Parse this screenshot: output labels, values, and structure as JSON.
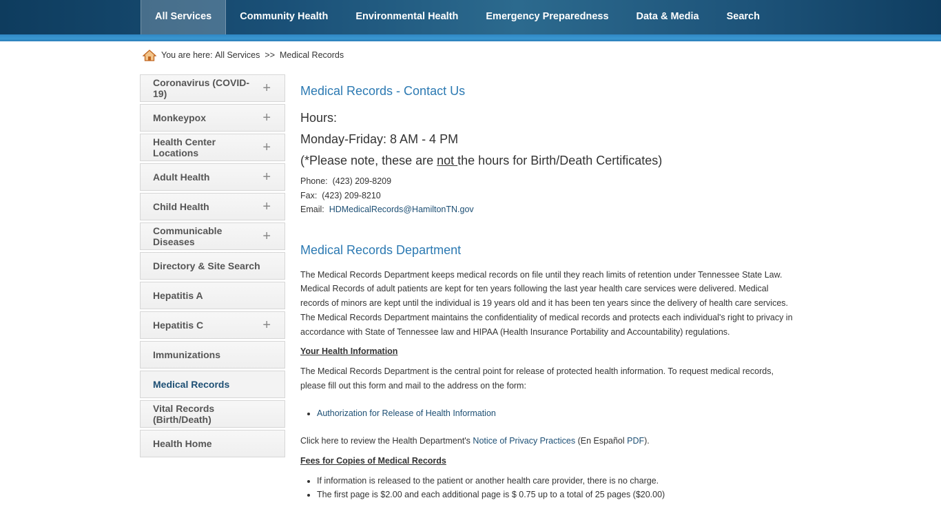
{
  "nav": {
    "items": [
      {
        "label": "All Services",
        "active": true
      },
      {
        "label": "Community Health"
      },
      {
        "label": "Environmental Health"
      },
      {
        "label": "Emergency Preparedness"
      },
      {
        "label": "Data & Media"
      },
      {
        "label": "Search"
      }
    ]
  },
  "breadcrumb": {
    "prefix": "You are here:",
    "parent": "All Services",
    "separator": ">>",
    "current": "Medical Records"
  },
  "sidebar": {
    "items": [
      {
        "label": "Coronavirus (COVID-19)",
        "plus": "+"
      },
      {
        "label": "Monkeypox",
        "plus": "+"
      },
      {
        "label": "Health Center Locations",
        "plus": "+"
      },
      {
        "label": "Adult Health",
        "plus": "+"
      },
      {
        "label": "Child Health",
        "plus": "+"
      },
      {
        "label": "Communicable Diseases",
        "plus": "+"
      },
      {
        "label": "Directory & Site Search",
        "plus": ""
      },
      {
        "label": "Hepatitis A",
        "plus": ""
      },
      {
        "label": "Hepatitis C",
        "plus": "+"
      },
      {
        "label": "Immunizations",
        "plus": ""
      },
      {
        "label": "Medical Records",
        "plus": "",
        "current": true
      },
      {
        "label": "Vital Records (Birth/Death)",
        "plus": ""
      },
      {
        "label": "Health Home",
        "plus": ""
      }
    ]
  },
  "contact": {
    "title": "Medical Records - Contact Us",
    "hours_label": "Hours:",
    "hours": "Monday-Friday: 8 AM - 4 PM",
    "note_pre": "(*Please note, these are ",
    "note_not": "not ",
    "note_post": "the hours for Birth/Death Certificates)",
    "phone_label": "Phone:",
    "phone": "(423) 209-8209",
    "fax_label": "Fax:",
    "fax": "(423) 209-8210",
    "email_label": "Email:",
    "email": "HDMedicalRecords@HamiltonTN.gov"
  },
  "department": {
    "title": "Medical Records Department",
    "intro": "The Medical Records Department keeps medical records on file until they reach limits of retention under Tennessee State Law. Medical Records of adult patients are kept for ten years following the last year health care services were delivered. Medical records of minors are kept until the individual is 19 years old and it has been ten years since the delivery of health care services. The Medical Records Department maintains the confidentiality of medical records and protects each individual's right to privacy in accordance with State of Tennessee law and HIPAA (Health Insurance Portability and Accountability) regulations.",
    "your_info_heading": "Your Health Information",
    "your_info_text": "The Medical Records Department is the central point for release of protected health information. To request medical records, please fill out this form and mail to the address on the form:",
    "auth_link": "Authorization for Release of Health Information",
    "privacy_pre": "Click here to review the Health Department's ",
    "privacy_link": "Notice of Privacy Practices",
    "privacy_mid": " (En Español ",
    "privacy_pdf": "PDF",
    "privacy_post": ").",
    "fees_heading": "Fees for Copies of Medical Records",
    "fees": [
      "If information is released to the patient or another health care provider, there is no charge.",
      "The first page is $2.00 and each additional page is $ 0.75 up to a total of 25 pages ($20.00)"
    ]
  }
}
